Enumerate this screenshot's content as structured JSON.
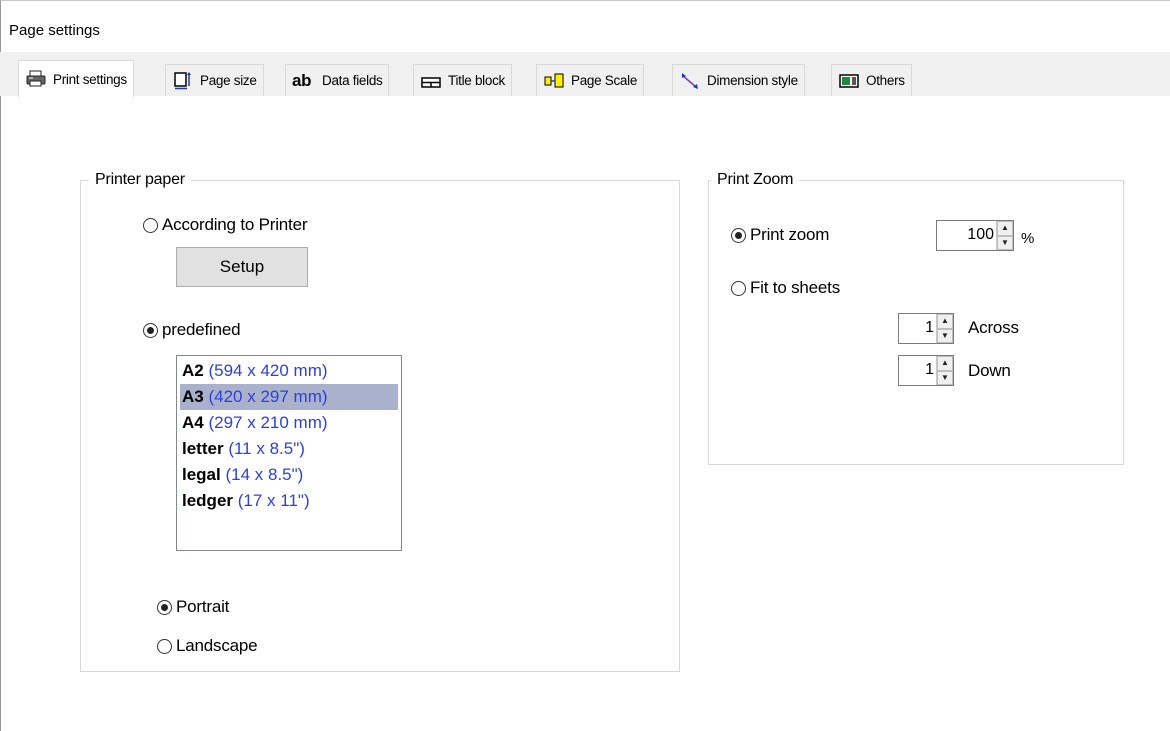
{
  "window": {
    "title": "Page settings"
  },
  "tabs": [
    {
      "label": "Print settings",
      "icon": "printer-icon",
      "active": true
    },
    {
      "label": "Page size",
      "icon": "page-size-icon"
    },
    {
      "label": "Data fields",
      "icon": "text-ab-icon"
    },
    {
      "label": "Title block",
      "icon": "title-block-icon"
    },
    {
      "label": "Page Scale",
      "icon": "page-scale-icon"
    },
    {
      "label": "Dimension style",
      "icon": "dimension-icon"
    },
    {
      "label": "Others",
      "icon": "others-icon"
    }
  ],
  "printer_paper": {
    "legend": "Printer paper",
    "according_label": "According to Printer",
    "according_checked": false,
    "setup_label": "Setup",
    "predefined_label": "predefined",
    "predefined_checked": true,
    "papers": [
      {
        "size": "A2",
        "dims": "(594 x 420 mm)",
        "selected": false
      },
      {
        "size": "A3",
        "dims": "(420 x 297 mm)",
        "selected": true
      },
      {
        "size": "A4",
        "dims": "(297 x 210 mm)",
        "selected": false
      },
      {
        "size": "letter",
        "dims": "(11 x 8.5\")",
        "selected": false
      },
      {
        "size": "legal",
        "dims": "(14 x 8.5\")",
        "selected": false
      },
      {
        "size": "ledger",
        "dims": "(17 x 11\")",
        "selected": false
      }
    ],
    "portrait_label": "Portrait",
    "portrait_checked": true,
    "landscape_label": "Landscape",
    "landscape_checked": false
  },
  "print_zoom": {
    "legend": "Print Zoom",
    "zoom_label": "Print zoom",
    "zoom_checked": true,
    "zoom_value": "100",
    "percent": "%",
    "fit_label": "Fit to sheets",
    "fit_checked": false,
    "across_value": "1",
    "across_label": "Across",
    "down_value": "1",
    "down_label": "Down"
  }
}
